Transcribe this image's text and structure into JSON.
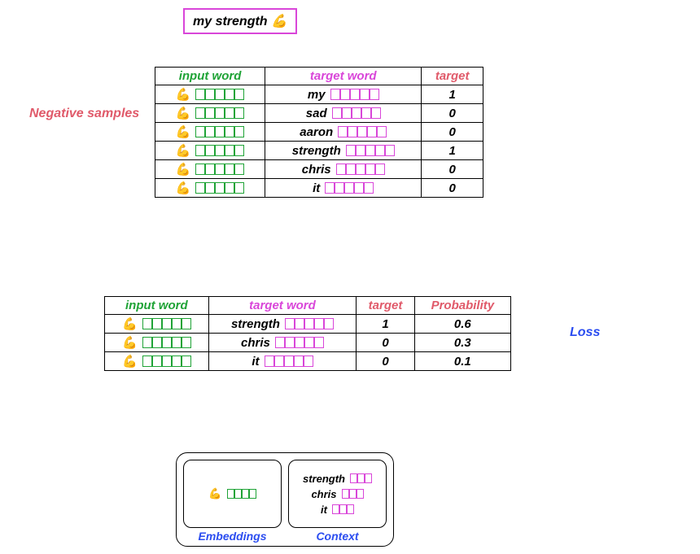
{
  "context_sentence": "my strength 💪",
  "labels": {
    "negative_samples": "Negative samples",
    "loss": "Loss",
    "input_word": "input word",
    "target_word": "target word",
    "target": "target",
    "probability": "Probability",
    "embeddings": "Embeddings",
    "context": "Context"
  },
  "table1": {
    "rows": [
      {
        "input": "💪",
        "target_word": "my",
        "target": "1"
      },
      {
        "input": "💪",
        "target_word": "sad",
        "target": "0"
      },
      {
        "input": "💪",
        "target_word": "aaron",
        "target": "0"
      },
      {
        "input": "💪",
        "target_word": "strength",
        "target": "1"
      },
      {
        "input": "💪",
        "target_word": "chris",
        "target": "0"
      },
      {
        "input": "💪",
        "target_word": "it",
        "target": "0"
      }
    ]
  },
  "table2": {
    "rows": [
      {
        "input": "💪",
        "target_word": "strength",
        "target": "1",
        "prob": "0.6"
      },
      {
        "input": "💪",
        "target_word": "chris",
        "target": "0",
        "prob": "0.3"
      },
      {
        "input": "💪",
        "target_word": "it",
        "target": "0",
        "prob": "0.1"
      }
    ]
  },
  "panel": {
    "embedding_token": "💪",
    "context_words": [
      "strength",
      "chris",
      "it"
    ]
  }
}
